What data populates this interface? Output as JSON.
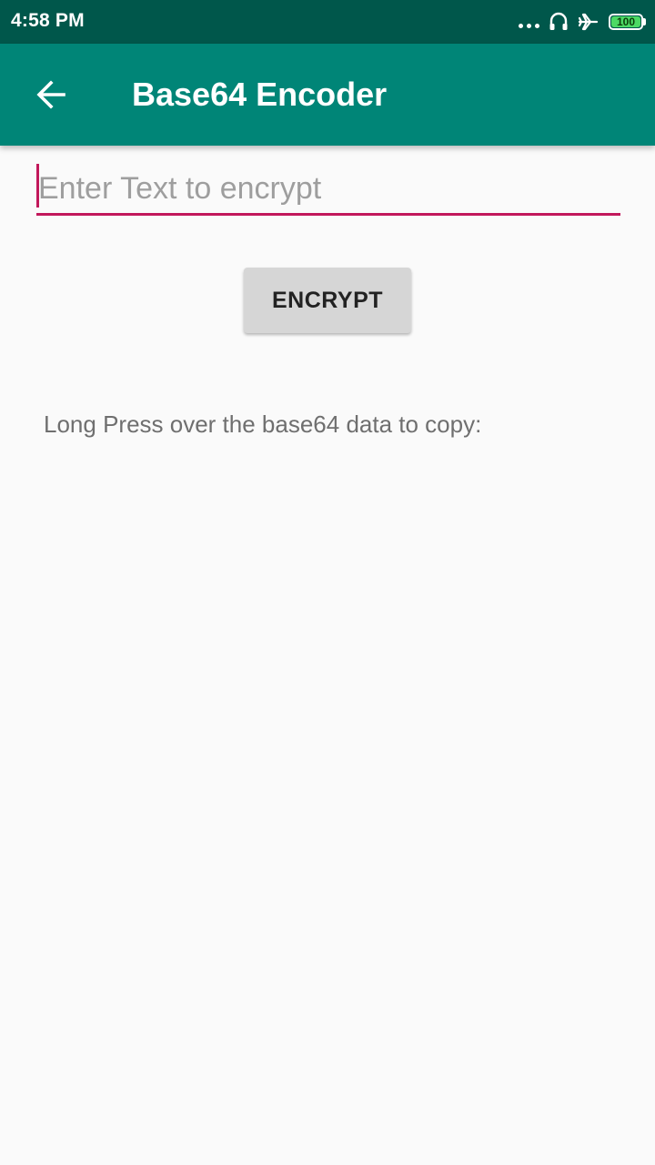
{
  "status_bar": {
    "time": "4:58 PM",
    "battery_level": "100",
    "icons": [
      "more-dots-icon",
      "headset-icon",
      "airplane-icon",
      "battery-icon"
    ],
    "colors": {
      "background": "#00574b",
      "battery_fill": "#4cd964"
    }
  },
  "app_bar": {
    "title": "Base64 Encoder",
    "back_icon": "arrow-back-icon",
    "colors": {
      "background": "#008577",
      "text": "#ffffff"
    }
  },
  "form": {
    "input_placeholder": "Enter Text to encrypt",
    "input_value": "",
    "button_label": "ENCRYPT",
    "hint": "Long Press over the base64 data to copy:",
    "output_value": "",
    "colors": {
      "accent": "#c2185b",
      "button": "#d6d6d6"
    }
  }
}
